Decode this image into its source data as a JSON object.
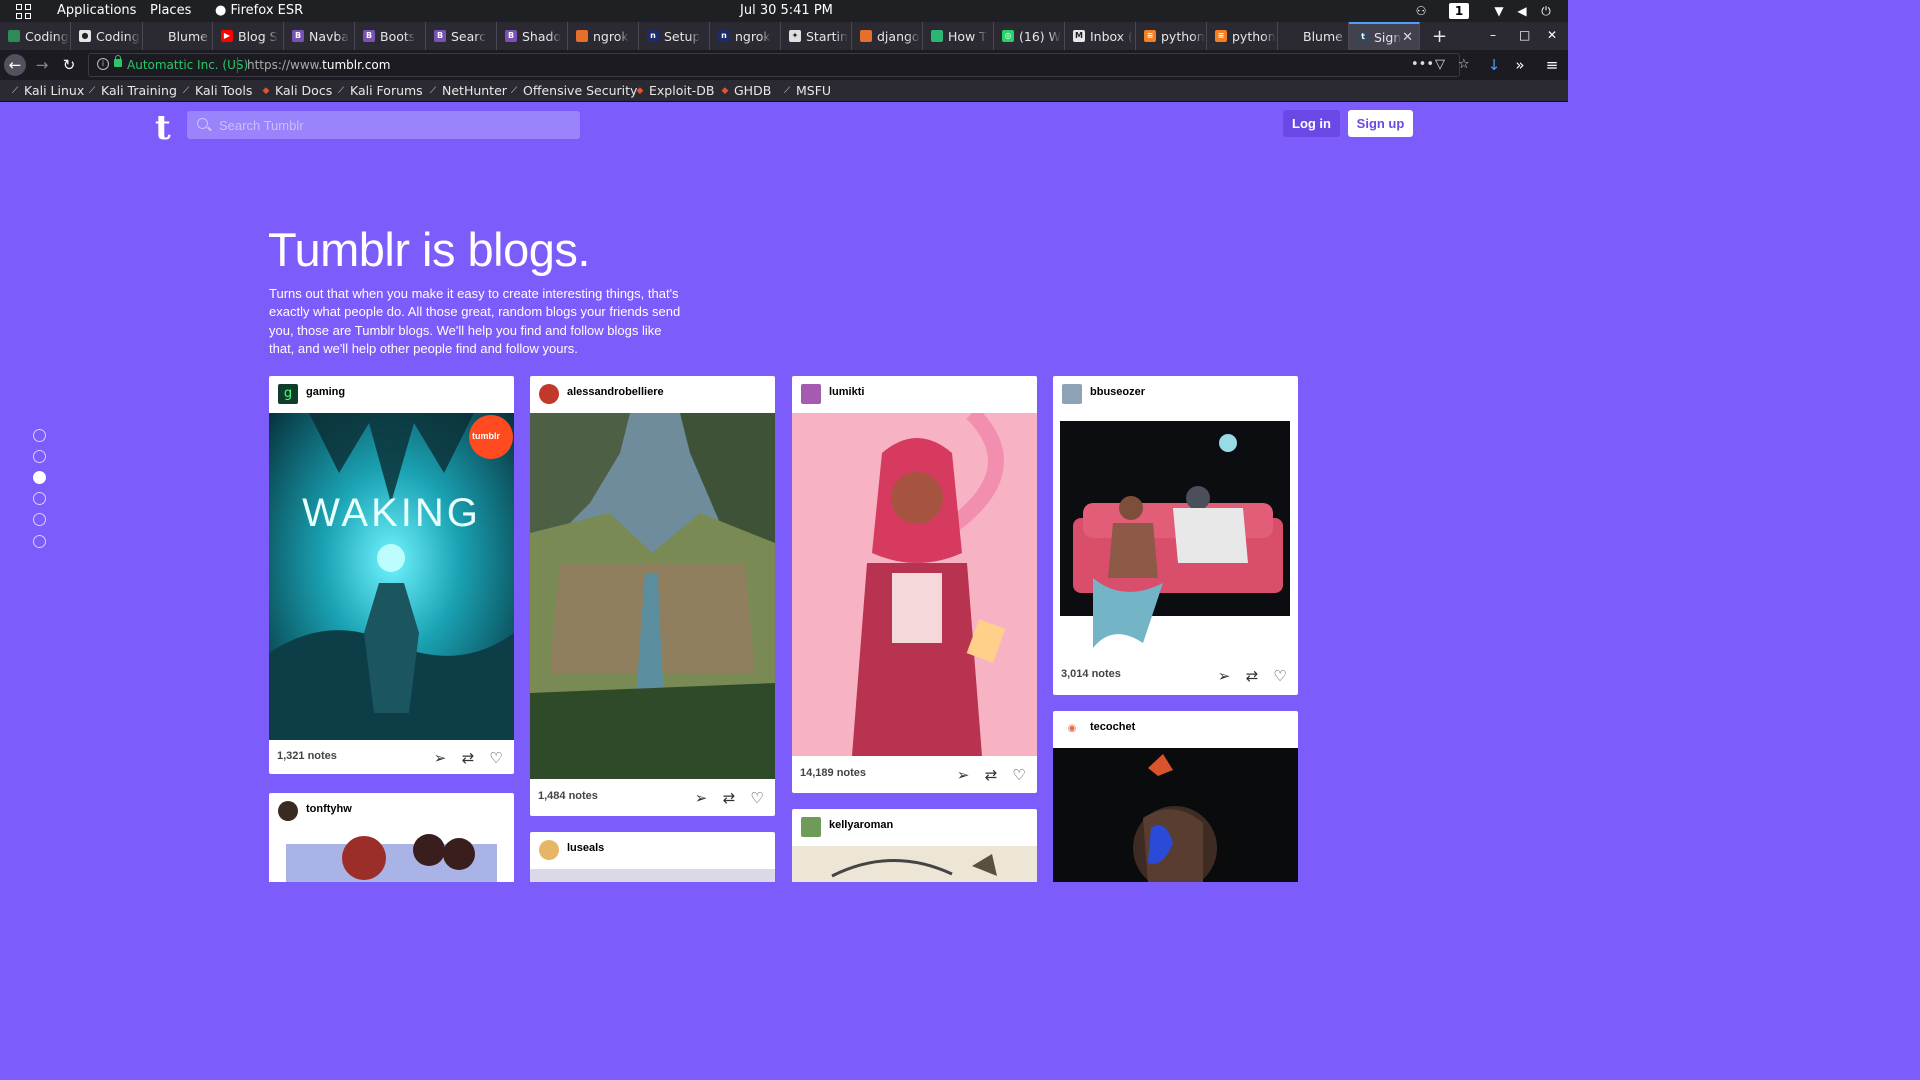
{
  "os": {
    "applications": "Applications",
    "places": "Places",
    "active_app": "Firefox ESR",
    "clock": "Jul 30   5:41 PM",
    "workspace": "1"
  },
  "tabs": [
    {
      "label": "Coding",
      "fav": "green"
    },
    {
      "label": "Coding",
      "fav": "github"
    },
    {
      "label": "Blume ❄",
      "fav": "none"
    },
    {
      "label": "Blog S",
      "fav": "youtube"
    },
    {
      "label": "Navba",
      "fav": "bootstrap"
    },
    {
      "label": "Boots",
      "fav": "bootstrap"
    },
    {
      "label": "Searc",
      "fav": "bootstrap"
    },
    {
      "label": "Shado",
      "fav": "bootstrap"
    },
    {
      "label": "ngrok",
      "fav": "orange"
    },
    {
      "label": "Setup",
      "fav": "ngrok"
    },
    {
      "label": "ngrok",
      "fav": "ngrok"
    },
    {
      "label": "Startin",
      "fav": "gear"
    },
    {
      "label": "django",
      "fav": "orange"
    },
    {
      "label": "How T",
      "fav": "green2"
    },
    {
      "label": "(16) W",
      "fav": "whatsapp"
    },
    {
      "label": "Inbox (",
      "fav": "gmail"
    },
    {
      "label": "python",
      "fav": "so"
    },
    {
      "label": "python",
      "fav": "so"
    },
    {
      "label": "Blume ❄",
      "fav": "none"
    },
    {
      "label": "Sign",
      "fav": "tumblr",
      "active": true
    }
  ],
  "nav": {
    "cert_owner": "Automattic Inc. (US)",
    "url_prefix": "https://www.",
    "url_domain": "tumblr.com"
  },
  "bookmarks": [
    "Kali Linux",
    "Kali Training",
    "Kali Tools",
    "Kali Docs",
    "Kali Forums",
    "NetHunter",
    "Offensive Security",
    "Exploit-DB",
    "GHDB",
    "MSFU"
  ],
  "tumblr": {
    "logo": "t",
    "search_placeholder": "Search Tumblr",
    "login": "Log in",
    "signup": "Sign up",
    "headline": "Tumblr is blogs.",
    "intro": "Turns out that when you make it easy to create interesting things, that's exactly what people do. All those great, random blogs your friends send you, those are Tumblr blogs. We'll help you find and follow blogs like that, and we'll help other people find and follow yours.",
    "active_dot": 3
  },
  "posts": {
    "gaming": {
      "user": "gaming",
      "notes": "1,321 notes",
      "art_title": "WAKING",
      "badge": "tumblr"
    },
    "alessandro": {
      "user": "alessandrobelliere",
      "notes": "1,484 notes"
    },
    "lumikti": {
      "user": "lumikti",
      "notes": "14,189 notes"
    },
    "bbuseozer": {
      "user": "bbuseozer",
      "notes": "3,014 notes"
    },
    "tonftyhw": {
      "user": "tonftyhw"
    },
    "luseals": {
      "user": "luseals"
    },
    "kellyaroman": {
      "user": "kellyaroman"
    },
    "tecochet": {
      "user": "tecochet"
    }
  }
}
